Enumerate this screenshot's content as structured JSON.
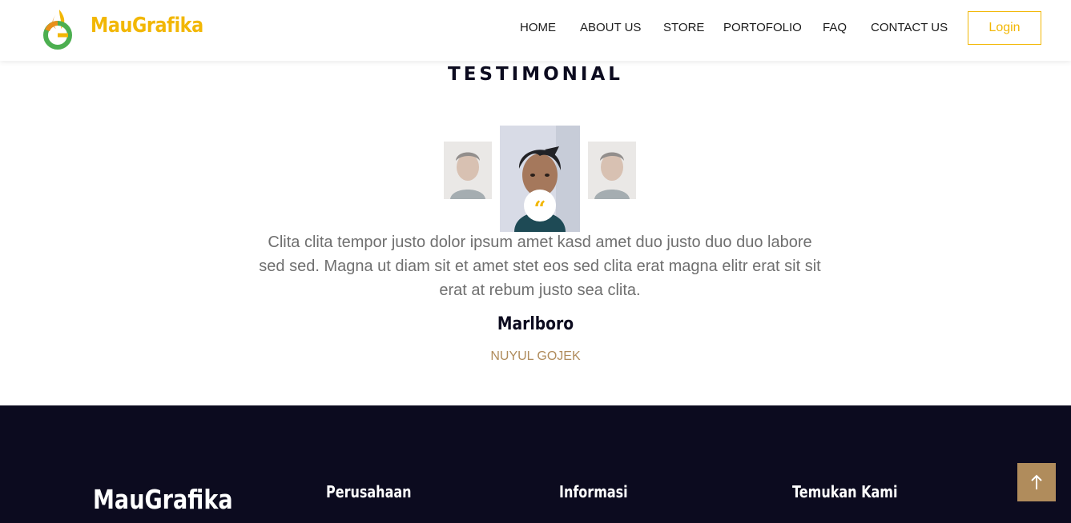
{
  "header": {
    "brand": "MauGrafika",
    "nav": [
      "HOME",
      "ABOUT US",
      "STORE",
      "PORTOFOLIO",
      "FAQ",
      "CONTACT US"
    ],
    "login_label": "Login"
  },
  "testimonial": {
    "title": "TESTIMONIAL",
    "quote_icon": "quote-icon",
    "text": "Clita clita tempor justo dolor ipsum amet kasd amet duo justo duo duo labore sed sed. Magna ut diam sit et amet stet eos sed clita erat magna elitr erat sit sit erat at rebum justo sea clita.",
    "name": "Marlboro",
    "role": "NUYUL GOJEK"
  },
  "footer": {
    "brand": "MauGrafika",
    "col1": "Perusahaan",
    "col2": "Informasi",
    "col3": "Temukan Kami"
  },
  "back_to_top_icon": "arrow-up-icon",
  "colors": {
    "accent": "#f2b705",
    "dark": "#0c0b1f",
    "tan": "#b08c5c",
    "body_text": "#6f6f6f"
  }
}
